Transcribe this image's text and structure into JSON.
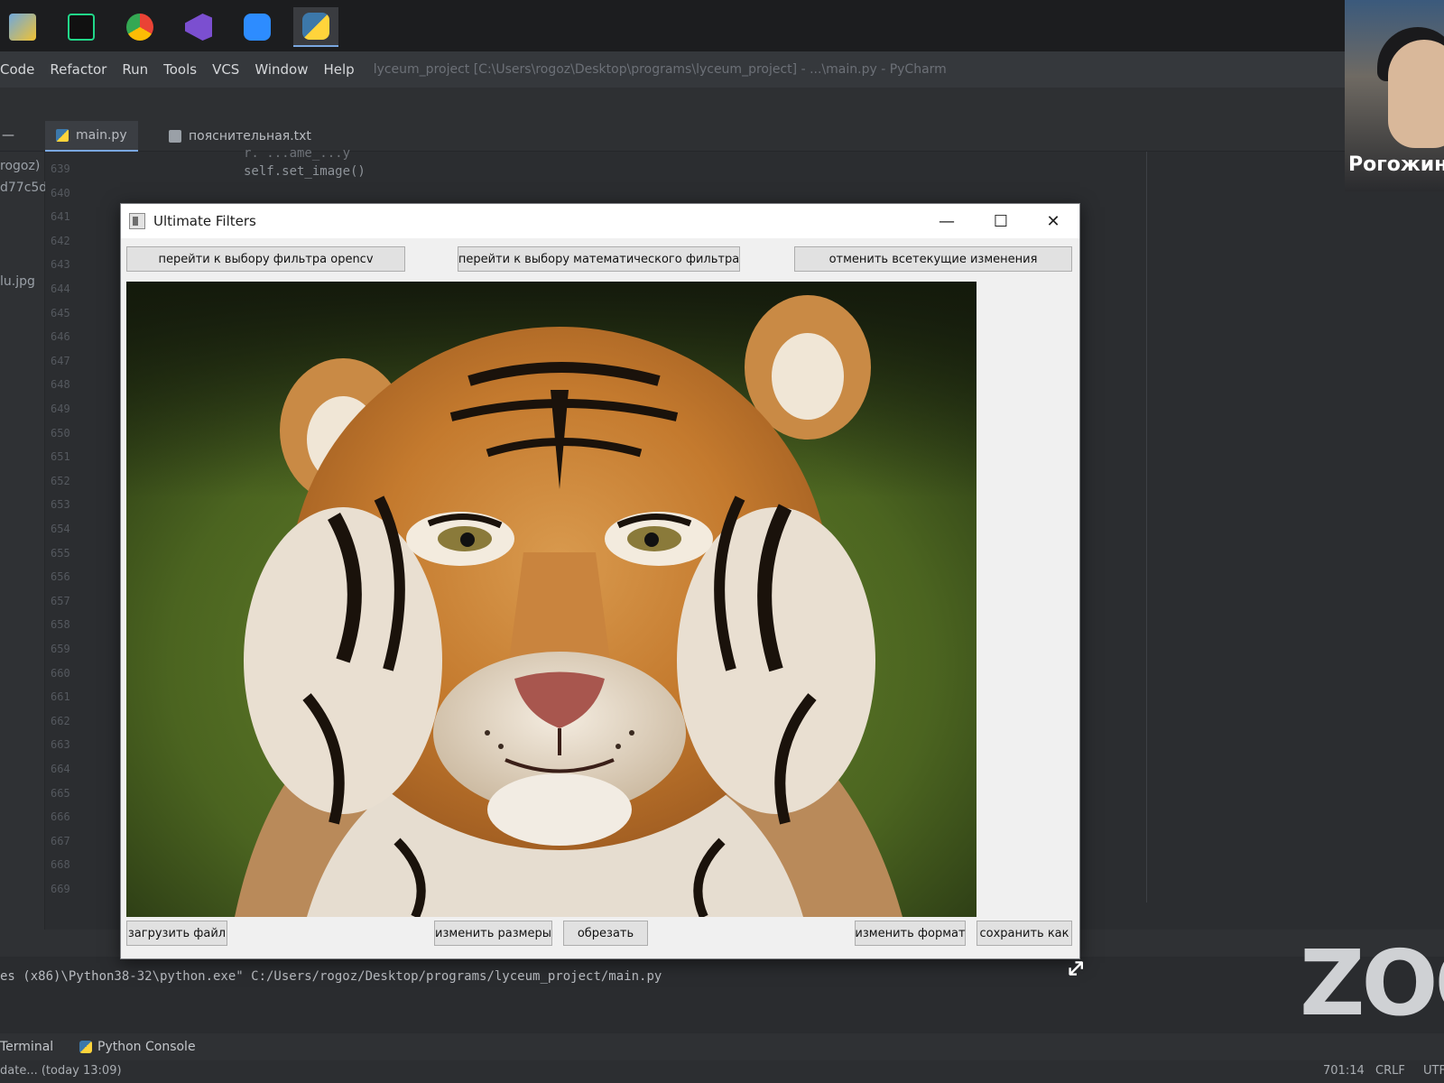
{
  "taskbar": {
    "apps": [
      "file-explorer-icon",
      "pycharm-icon",
      "chrome-icon",
      "visual-studio-icon",
      "zoom-icon",
      "python-icon"
    ]
  },
  "menubar": {
    "items": [
      "Code",
      "Refactor",
      "Run",
      "Tools",
      "VCS",
      "Window",
      "Help"
    ],
    "title": "lyceum_project [C:\\Users\\rogoz\\Desktop\\programs\\lyceum_project] - ...\\main.py - PyCharm"
  },
  "editor_tabs": [
    {
      "label": "main.py",
      "active": true
    },
    {
      "label": "пояснительная.txt",
      "active": false
    }
  ],
  "project_panel": {
    "items": [
      "rogoz)",
      "d77c5d",
      "lu.jpg"
    ]
  },
  "gutter": {
    "lines": [
      "639",
      "640",
      "641",
      "642",
      "643",
      "644",
      "645",
      "646",
      "647",
      "648",
      "649",
      "650",
      "651",
      "652",
      "653",
      "654",
      "655",
      "656",
      "657",
      "658",
      "659",
      "660",
      "661",
      "662",
      "663",
      "664",
      "665",
      "666",
      "667",
      "668",
      "669"
    ]
  },
  "code": {
    "line_top": "r. ...ame_...y",
    "line_main": "self.set_image()"
  },
  "console": {
    "command": "es (x86)\\Python38-32\\python.exe\" C:/Users/rogoz/Desktop/programs/lyceum_project/main.py"
  },
  "bottom_tabs": {
    "terminal": "Terminal",
    "python_console": "Python Console"
  },
  "statusbar": {
    "left": "date... (today 13:09)",
    "position": "701:14",
    "line_ending": "CRLF",
    "encoding": "UTF"
  },
  "zoom": {
    "participant_name": "Рогожин",
    "logo": "ZOO"
  },
  "app_window": {
    "title": "Ultimate Filters",
    "top_buttons": {
      "opencv": "перейти к выбору фильтра opencv",
      "math": "перейти к выбору математического фильтра",
      "undo": "отменить всетекущие изменения"
    },
    "bottom_buttons": {
      "load": "загрузить файл",
      "resize": "изменить размеры",
      "crop": "обрезать",
      "format": "изменить формат",
      "save_as": "сохранить как"
    }
  },
  "colors": {
    "ide_bg": "#2b2d30",
    "window_bg": "#f0f0f0",
    "accent": "#7aa7e0"
  }
}
